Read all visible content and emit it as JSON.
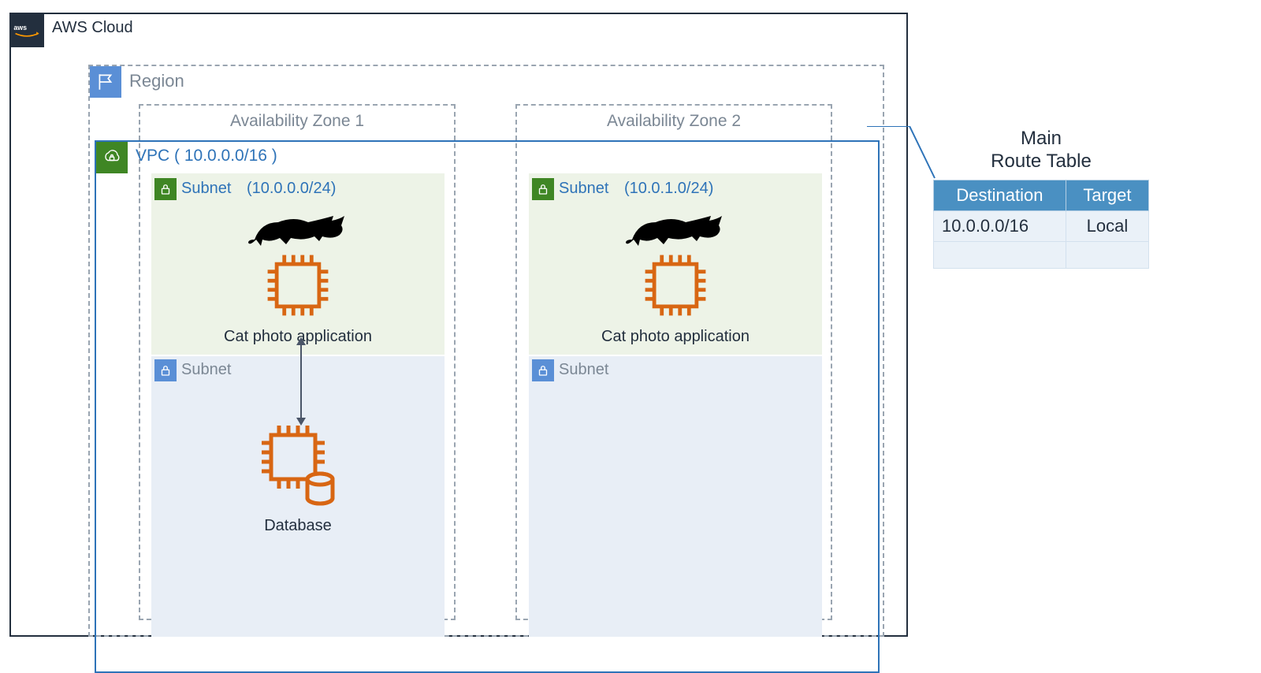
{
  "cloud": {
    "label": "AWS Cloud"
  },
  "region": {
    "label": "Region"
  },
  "vpc": {
    "label": "VPC  ( 10.0.0.0/16 )"
  },
  "az": {
    "one": "Availability Zone 1",
    "two": "Availability Zone 2"
  },
  "subnets": {
    "sn1": {
      "title": "Subnet",
      "cidr": "(10.0.0.0/24)"
    },
    "sn2": {
      "title": "Subnet",
      "cidr": "(10.0.1.0/24)"
    },
    "sn3": {
      "title": "Subnet"
    },
    "sn4": {
      "title": "Subnet"
    }
  },
  "app": {
    "caption": "Cat photo application"
  },
  "db": {
    "caption": "Database"
  },
  "routeTable": {
    "title1": "Main",
    "title2": "Route Table",
    "headers": {
      "dest": "Destination",
      "target": "Target"
    },
    "rows": [
      {
        "dest": "10.0.0.0/16",
        "target": "Local"
      },
      {
        "dest": "",
        "target": ""
      }
    ]
  }
}
